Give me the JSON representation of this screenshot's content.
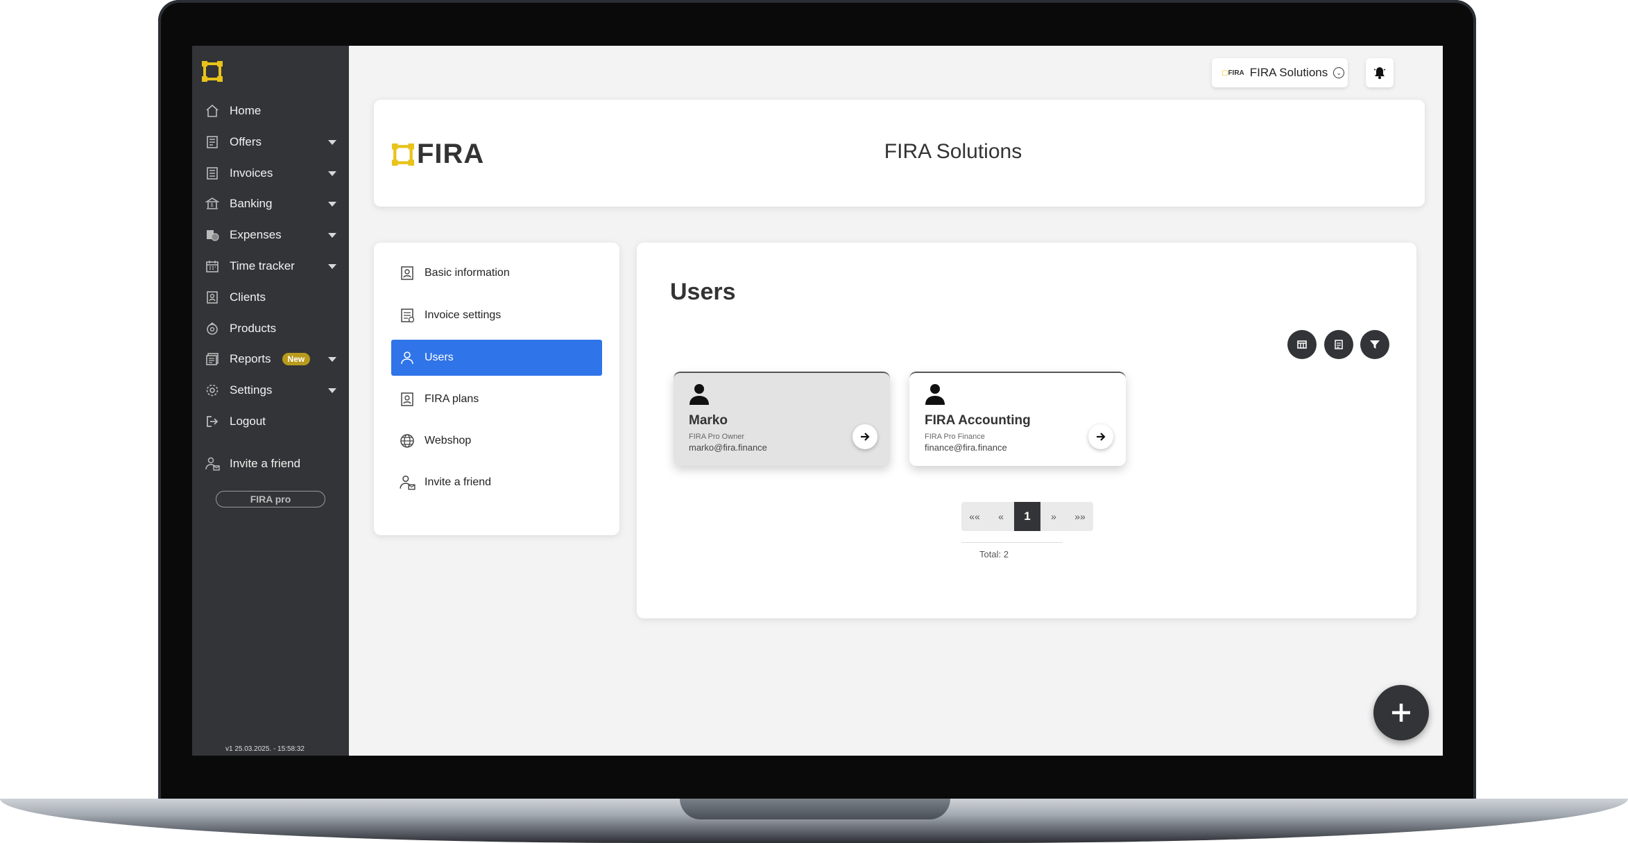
{
  "sidebar": {
    "items": [
      {
        "label": "Home",
        "icon": "home-icon",
        "caret": false
      },
      {
        "label": "Offers",
        "icon": "document-icon",
        "caret": true
      },
      {
        "label": "Invoices",
        "icon": "invoice-icon",
        "caret": true
      },
      {
        "label": "Banking",
        "icon": "bank-icon",
        "caret": true
      },
      {
        "label": "Expenses",
        "icon": "expenses-icon",
        "caret": true
      },
      {
        "label": "Time tracker",
        "icon": "calendar-icon",
        "caret": true
      },
      {
        "label": "Clients",
        "icon": "clients-icon",
        "caret": false
      },
      {
        "label": "Products",
        "icon": "products-icon",
        "caret": false
      },
      {
        "label": "Reports",
        "icon": "reports-icon",
        "caret": true,
        "badge": "New"
      },
      {
        "label": "Settings",
        "icon": "gear-icon",
        "caret": true
      },
      {
        "label": "Logout",
        "icon": "logout-icon",
        "caret": false
      },
      {
        "label": "Invite a friend",
        "icon": "invite-friend-icon",
        "caret": false
      }
    ],
    "pro_button": "FIRA pro",
    "version": "v1 25.03.2025. - 15:58:32"
  },
  "topbar": {
    "company_logo_text": "FIRA",
    "company_name": "FIRA Solutions"
  },
  "header": {
    "logo_text": "FIRA",
    "company_title": "FIRA Solutions"
  },
  "settings_menu": {
    "items": [
      {
        "label": "Basic information",
        "icon": "profile-card-icon"
      },
      {
        "label": "Invoice settings",
        "icon": "invoice-settings-icon"
      },
      {
        "label": "Users",
        "icon": "user-icon",
        "active": true
      },
      {
        "label": "FIRA plans",
        "icon": "plans-icon"
      },
      {
        "label": "Webshop",
        "icon": "globe-icon"
      },
      {
        "label": "Invite a friend",
        "icon": "invite-friend-icon"
      }
    ]
  },
  "users": {
    "title": "Users",
    "toolbar": [
      "table-view-icon",
      "export-icon",
      "filter-icon"
    ],
    "list": [
      {
        "name": "Marko",
        "role": "FIRA Pro Owner",
        "email": "marko@fira.finance"
      },
      {
        "name": "FIRA Accounting",
        "role": "FIRA Pro Finance",
        "email": "finance@fira.finance"
      }
    ],
    "pagination": {
      "first": "««",
      "prev": "«",
      "current": "1",
      "next": "»",
      "last": "»»"
    },
    "total": "Total: 2"
  },
  "colors": {
    "sidebar": "#333437",
    "accent": "#2f74e8",
    "brand_yellow": "#e8c31a",
    "badge": "#b99a1c"
  }
}
